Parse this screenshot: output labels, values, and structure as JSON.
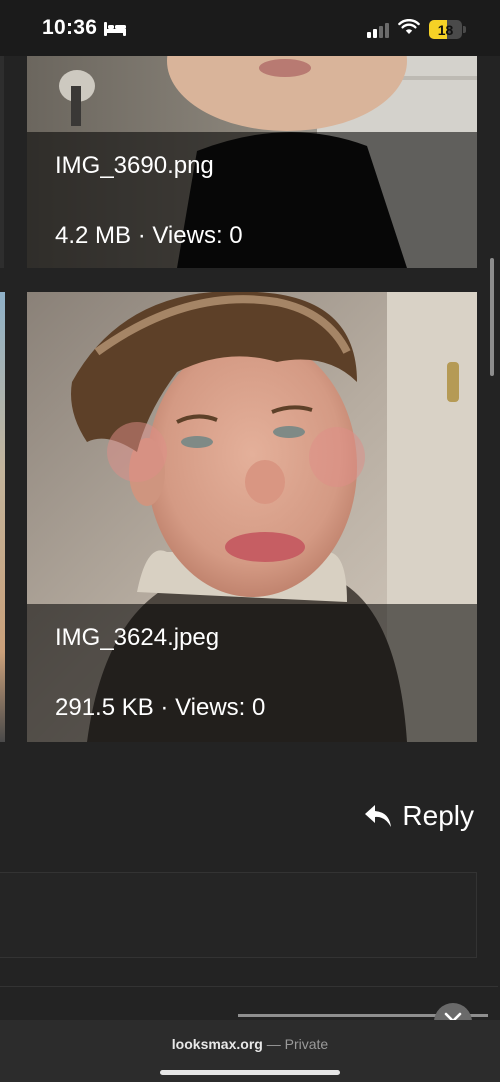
{
  "status_bar": {
    "time": "10:36",
    "battery": "18",
    "icons": [
      "bed-icon",
      "cellular-signal-icon",
      "wifi-icon",
      "battery-icon"
    ]
  },
  "attachments": [
    {
      "file_name": "IMG_3690.png",
      "meta": "4.2 MB · Views: 0"
    },
    {
      "file_name": "IMG_3624.jpeg",
      "meta": "291.5 KB · Views: 0"
    }
  ],
  "actions": {
    "reply_label": "Reply",
    "reply_icon": "reply-arrow-icon"
  },
  "browser": {
    "domain": "looksmax.org",
    "separator": " — ",
    "mode": "Private"
  },
  "colors": {
    "background": "#232323",
    "overlay": "rgba(0,0,0,0.55)",
    "battery_fill": "#f6d226"
  }
}
